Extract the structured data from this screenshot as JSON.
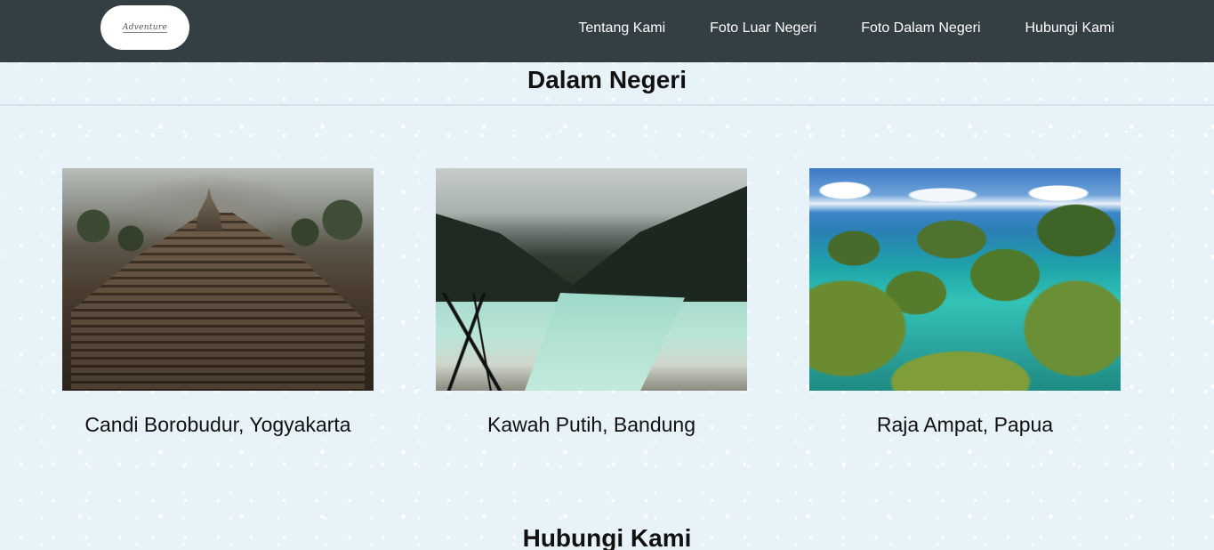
{
  "navbar": {
    "logo_text": "Adventure",
    "links": [
      {
        "label": "Tentang Kami"
      },
      {
        "label": "Foto Luar Negeri"
      },
      {
        "label": "Foto Dalam Negeri"
      },
      {
        "label": "Hubungi Kami"
      }
    ]
  },
  "sections": {
    "dalam_negeri": {
      "title": "Dalam Negeri",
      "cards": [
        {
          "caption": "Candi Borobudur, Yogyakarta",
          "image": "borobudur-photo"
        },
        {
          "caption": "Kawah Putih, Bandung",
          "image": "kawah-putih-photo"
        },
        {
          "caption": "Raja Ampat, Papua",
          "image": "raja-ampat-photo"
        }
      ]
    },
    "hubungi_kami": {
      "title": "Hubungi Kami"
    }
  },
  "colors": {
    "navbar_bg": "#343f44",
    "page_bg": "#e8f3f9",
    "nav_text": "#ffffff"
  }
}
